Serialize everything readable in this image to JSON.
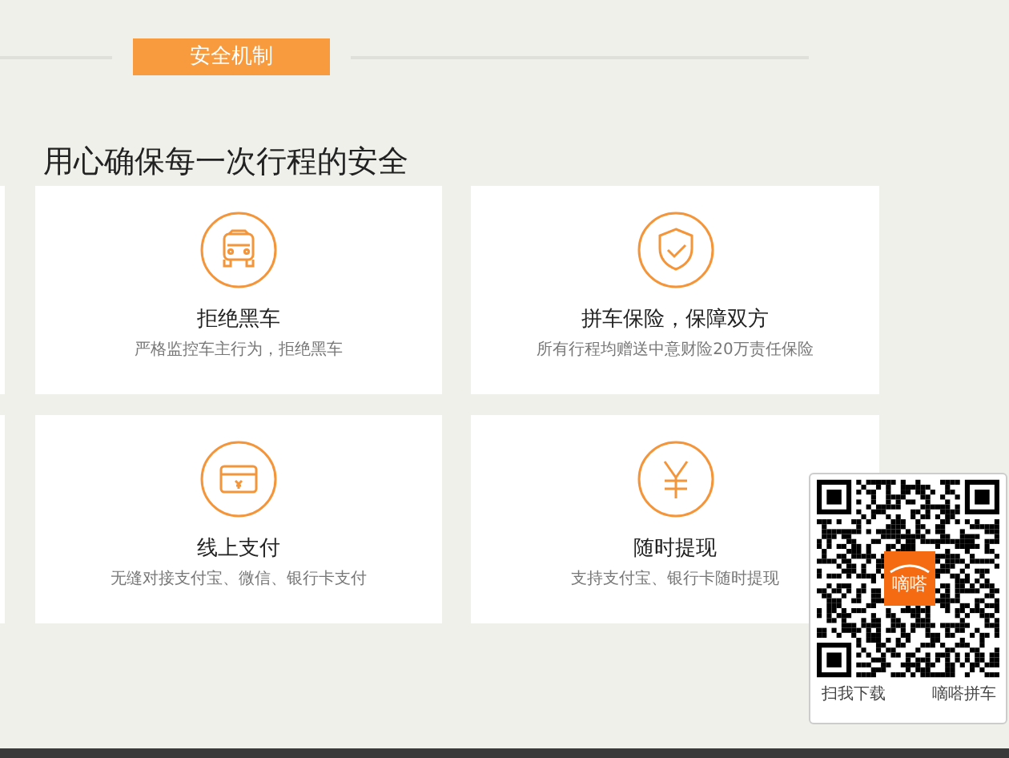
{
  "section_tab": {
    "label": "安全机制"
  },
  "heading": "用心确保每一次行程的安全",
  "features": [
    {
      "kind": "car",
      "title": "拒绝黑车",
      "subtitle": "严格监控车主行为，拒绝黑车"
    },
    {
      "kind": "shield",
      "title": "拼车保险，保障双方",
      "subtitle": "所有行程均赠送中意财险20万责任保险"
    },
    {
      "kind": "card",
      "title": "线上支付",
      "subtitle": "无缝对接支付宝、微信、银行卡支付"
    },
    {
      "kind": "yen",
      "title": "随时提现",
      "subtitle": "支持支付宝、银行卡随时提现"
    }
  ],
  "qr_popup": {
    "logo_text": "嘀嗒",
    "labels": [
      "扫我下载",
      "嘀嗒拼车"
    ]
  }
}
